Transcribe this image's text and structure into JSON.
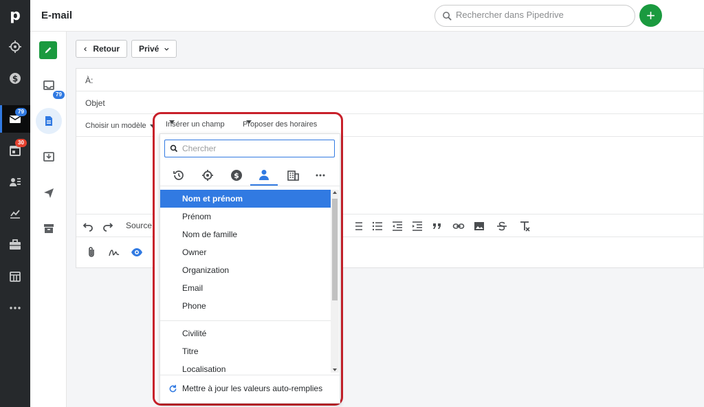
{
  "app": {
    "logo": "p",
    "title": "E-mail"
  },
  "nav": {
    "items": [
      {
        "icon": "target-icon"
      },
      {
        "icon": "dollar-icon"
      },
      {
        "icon": "mail-icon",
        "badge": "79",
        "active": true
      },
      {
        "icon": "calendar-icon",
        "badge": "30"
      },
      {
        "icon": "contacts-icon"
      },
      {
        "icon": "chart-icon"
      },
      {
        "icon": "briefcase-icon"
      },
      {
        "icon": "store-icon"
      },
      {
        "icon": "more-icon"
      }
    ]
  },
  "search": {
    "placeholder": "Rechercher dans Pipedrive"
  },
  "add_button": {
    "label": "+"
  },
  "sidebar": {
    "inbox_badge": "79"
  },
  "toolbar_top": {
    "back_label": "Retour",
    "visibility_label": "Privé"
  },
  "composer": {
    "to_label": "À:",
    "subject_label": "Objet",
    "options": [
      "Choisir un modèle",
      "Insérer un champ",
      "Proposer des horaires"
    ],
    "source_label": "Source"
  },
  "field_picker": {
    "search_placeholder": "Chercher",
    "categories": [
      "history-icon",
      "target-icon",
      "dollar-icon",
      "person-icon",
      "building-icon",
      "more-icon"
    ],
    "active_category": "person-icon",
    "items": [
      "Nom et prénom",
      "Prénom",
      "Nom de famille",
      "Owner",
      "Organization",
      "Email",
      "Phone",
      "Civilité",
      "Titre",
      "Localisation"
    ],
    "selected_item": "Nom et prénom",
    "footer_label": "Mettre à jour les valeurs auto-remplies"
  },
  "colors": {
    "accent": "#317ae2",
    "brand_green": "#1a9a3f",
    "highlight_border": "#c8202a",
    "nav_bg": "#26292c"
  }
}
